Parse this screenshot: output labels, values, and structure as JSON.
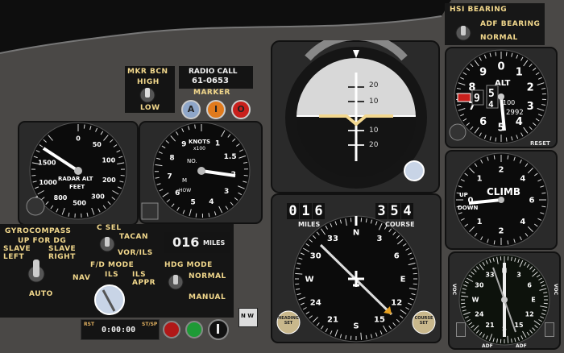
{
  "hsi_bearing_panel": {
    "hsi_bearing": "HSI BEARING",
    "adf_bearing": "ADF BEARING",
    "normal": "NORMAL"
  },
  "marker_beacon": {
    "mkr_bcn": "MKR BCN",
    "high": "HIGH",
    "low": "LOW",
    "radio_call_label": "RADIO CALL",
    "radio_call_value": "61-0653",
    "marker_label": "MARKER",
    "lights": [
      "A",
      "I",
      "O"
    ]
  },
  "attitude": {
    "pitch_labels": [
      "20",
      "10",
      "10",
      "20"
    ]
  },
  "altimeter": {
    "label": "ALT",
    "dial": [
      "0",
      "1",
      "2",
      "3",
      "4",
      "5",
      "6",
      "7",
      "8",
      "9"
    ],
    "drum_thousands": "9",
    "drum_hundreds_top": "5",
    "drum_hundreds_bottom": "4",
    "small_100": "100",
    "kollsman": "2992",
    "reset": "RESET"
  },
  "radar_alt": {
    "label_1": "RADAR ALT",
    "label_2": "FEET",
    "dial": [
      "0",
      "50",
      "100",
      "200",
      "300",
      "500",
      "800",
      "1000",
      "1500"
    ]
  },
  "airspeed": {
    "label_1": "KNOTS",
    "label_2": "x100",
    "dial": [
      "1",
      "1.5",
      "2",
      "3",
      "4",
      "5",
      "6",
      "7",
      "8",
      "9"
    ],
    "sub_1": "NO.",
    "sub_2": "M",
    "sub_3": "HOW"
  },
  "vsi": {
    "label": "CLIMB",
    "up": "UP",
    "down": "DOWN",
    "dial": [
      "0",
      "1",
      "2",
      "4",
      "6",
      "4",
      "2",
      "1"
    ]
  },
  "hsi": {
    "miles_digits": [
      "0",
      "1",
      "6"
    ],
    "miles_label": "MILES",
    "course_digits": [
      "3",
      "5",
      "4"
    ],
    "course_label": "COURSE",
    "card": [
      "N",
      "3",
      "6",
      "E",
      "12",
      "15",
      "S",
      "21",
      "24",
      "W",
      "30",
      "33"
    ],
    "heading_set": "HEADING SET",
    "course_set": "COURSE SET"
  },
  "mode_panel": {
    "gyrocompass": "GYROCOMPASS",
    "up_for_dg": "UP FOR DG",
    "slave_left": "SLAVE LEFT",
    "slave_right": "SLAVE RIGHT",
    "auto": "AUTO",
    "c_sel": "C SEL",
    "tacan": "TACAN",
    "vor_ils": "VOR/ILS",
    "fd_mode": "F/D MODE",
    "nav": "NAV",
    "ils": "ILS",
    "ils_appr": "ILS APPR",
    "dme_value": "016",
    "dme_unit": "MILES",
    "hdg_mode": "HDG MODE",
    "normal": "NORMAL",
    "manual": "MANUAL"
  },
  "clock": {
    "rst": "RST",
    "time": "0:00:00",
    "start_stop": "ST/SP"
  },
  "adf": {
    "voc_left": "VOC",
    "voc_right": "VOC",
    "adf_left": "ADF",
    "adf_right": "ADF",
    "dial": [
      "N",
      "3",
      "6",
      "E",
      "12",
      "15",
      "S",
      "21",
      "24",
      "W",
      "30",
      "33"
    ]
  },
  "nw_box": "N W",
  "colors": {
    "panel": "#4a4846",
    "bezel": "#2b2b2b",
    "label_yellow": "#f2d88c",
    "marker_blue": "#8ea6c9",
    "marker_amber": "#e07a1c",
    "marker_red": "#c8201c",
    "attitude_sky": "#d8d8d8",
    "attitude_ground": "#141414"
  }
}
